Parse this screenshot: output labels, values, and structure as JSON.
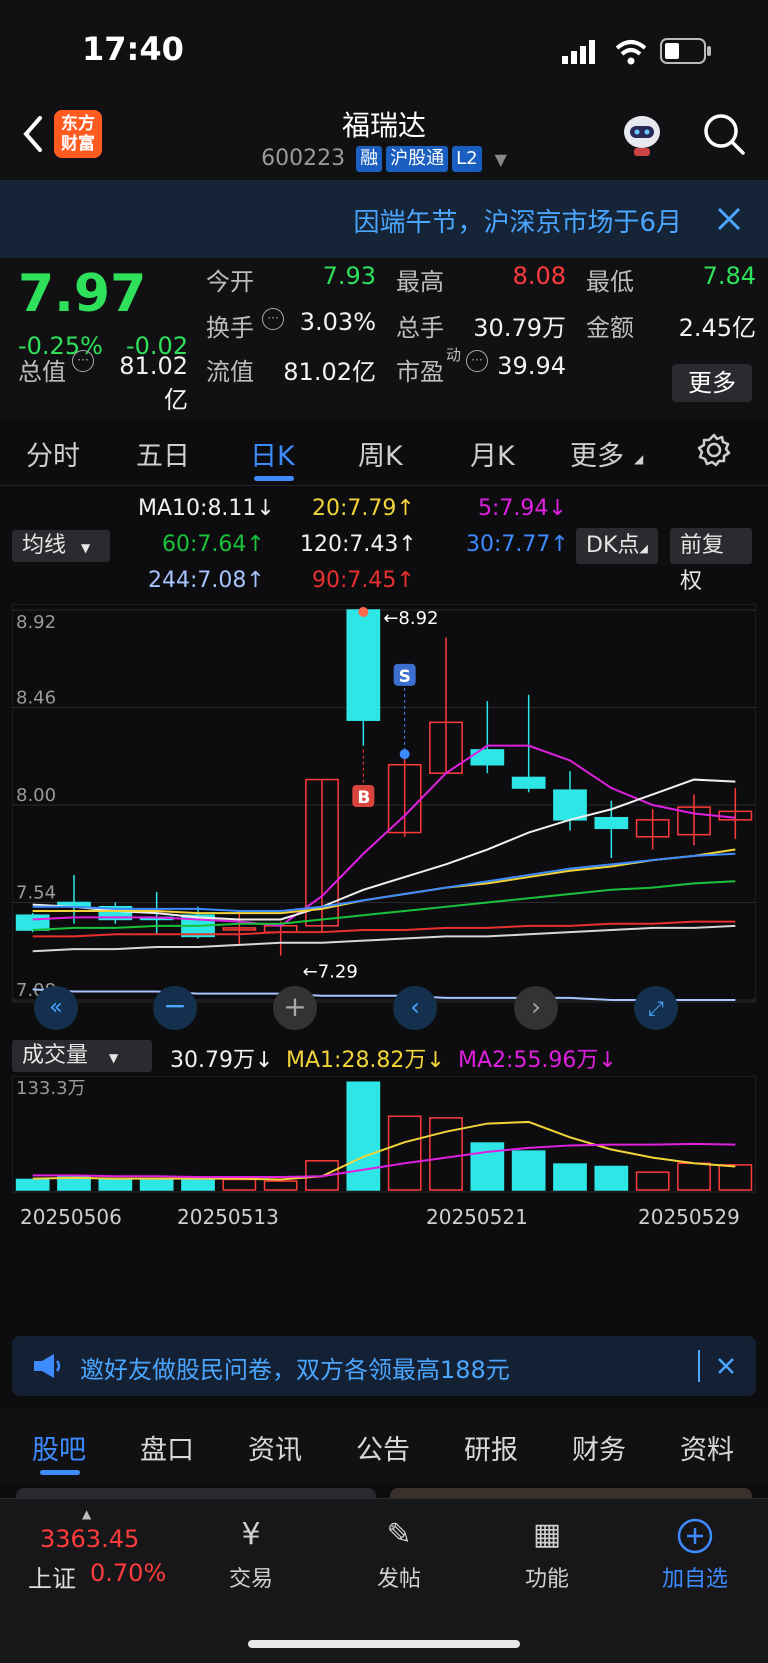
{
  "status": {
    "time": "17:40"
  },
  "header": {
    "logo_line1": "东方",
    "logo_line2": "财富",
    "title": "福瑞达",
    "code": "600223",
    "tags": [
      "融",
      "沪股通",
      "L2"
    ]
  },
  "notice": {
    "text": "因端午节，沪深京市场于6月"
  },
  "quote": {
    "price": "7.97",
    "change_pct": "-0.25%",
    "change": "-0.02",
    "open_label": "今开",
    "open": "7.93",
    "high_label": "最高",
    "high": "8.08",
    "low_label": "最低",
    "low": "7.84",
    "turnover_label": "换手",
    "turnover": "3.03%",
    "volume_label": "总手",
    "volume": "30.79万",
    "amount_label": "金额",
    "amount": "2.45亿",
    "mcap_label": "总值",
    "mcap": "81.02亿",
    "float_label": "流值",
    "float": "81.02亿",
    "pe_label": "市盈",
    "pe_sup": "动",
    "pe": "39.94",
    "more": "更多"
  },
  "tabs": [
    "分时",
    "五日",
    "日K",
    "周K",
    "月K",
    "更多"
  ],
  "ma": {
    "selector": "均线",
    "ma10": "MA10:8.11↓",
    "ma20": "20:7.79↑",
    "ma5": "5:7.94↓",
    "ma60": "60:7.64↑",
    "ma120": "120:7.43↑",
    "ma30": "30:7.77↑",
    "ma244": "244:7.08↑",
    "ma90": "90:7.45↑",
    "dk": "DK点",
    "fuquan": "前复权"
  },
  "chart_data": {
    "type": "candlestick",
    "y_ticks": [
      "8.92",
      "8.46",
      "8.00",
      "7.54",
      "7.08"
    ],
    "ylim": [
      7.08,
      8.92
    ],
    "high_marker": "←8.92",
    "low_marker": "←7.29",
    "signals": [
      "B",
      "S"
    ],
    "candles": [
      {
        "o": 7.48,
        "c": 7.41,
        "h": 7.49,
        "l": 7.4
      },
      {
        "o": 7.54,
        "c": 7.52,
        "h": 7.67,
        "l": 7.44
      },
      {
        "o": 7.52,
        "c": 7.46,
        "h": 7.54,
        "l": 7.44
      },
      {
        "o": 7.47,
        "c": 7.46,
        "h": 7.59,
        "l": 7.39
      },
      {
        "o": 7.48,
        "c": 7.38,
        "h": 7.52,
        "l": 7.37
      },
      {
        "o": 7.42,
        "c": 7.42,
        "h": 7.5,
        "l": 7.34
      },
      {
        "o": 7.4,
        "c": 7.43,
        "h": 7.45,
        "l": 7.29
      },
      {
        "o": 7.43,
        "c": 8.12,
        "h": 8.12,
        "l": 7.4
      },
      {
        "o": 8.92,
        "c": 8.4,
        "h": 8.92,
        "l": 8.28
      },
      {
        "o": 7.87,
        "c": 8.19,
        "h": 8.24,
        "l": 7.85
      },
      {
        "o": 8.15,
        "c": 8.39,
        "h": 8.79,
        "l": 8.15
      },
      {
        "o": 8.26,
        "c": 8.19,
        "h": 8.49,
        "l": 8.15
      },
      {
        "o": 8.13,
        "c": 8.08,
        "h": 8.52,
        "l": 8.06
      },
      {
        "o": 8.07,
        "c": 7.93,
        "h": 8.16,
        "l": 7.88
      },
      {
        "o": 7.94,
        "c": 7.89,
        "h": 8.02,
        "l": 7.75
      },
      {
        "o": 7.85,
        "c": 7.93,
        "h": 7.98,
        "l": 7.79
      },
      {
        "o": 7.86,
        "c": 7.99,
        "h": 8.05,
        "l": 7.81
      },
      {
        "o": 7.93,
        "c": 7.97,
        "h": 8.08,
        "l": 7.84
      }
    ],
    "ma_lines": [
      {
        "name": "MA5",
        "color": "#e020e0",
        "values": [
          7.46,
          7.47,
          7.47,
          7.47,
          7.46,
          7.45,
          7.43,
          7.57,
          7.77,
          7.95,
          8.15,
          8.28,
          8.28,
          8.21,
          8.08,
          8.0,
          7.96,
          7.94
        ]
      },
      {
        "name": "MA10",
        "color": "#f0f0f0",
        "values": [
          7.53,
          7.52,
          7.5,
          7.49,
          7.47,
          7.46,
          7.46,
          7.52,
          7.6,
          7.66,
          7.72,
          7.79,
          7.87,
          7.93,
          7.98,
          8.05,
          8.12,
          8.11
        ]
      },
      {
        "name": "MA20",
        "color": "#f2d43a",
        "values": [
          7.5,
          7.5,
          7.5,
          7.5,
          7.49,
          7.49,
          7.49,
          7.51,
          7.55,
          7.58,
          7.61,
          7.63,
          7.66,
          7.69,
          7.71,
          7.74,
          7.76,
          7.79
        ]
      },
      {
        "name": "MA30",
        "color": "#3d8bff",
        "values": [
          7.52,
          7.52,
          7.51,
          7.51,
          7.51,
          7.5,
          7.5,
          7.52,
          7.55,
          7.58,
          7.61,
          7.64,
          7.67,
          7.7,
          7.72,
          7.74,
          7.76,
          7.77
        ]
      },
      {
        "name": "MA60",
        "color": "#19c23a",
        "values": [
          7.41,
          7.42,
          7.42,
          7.43,
          7.43,
          7.44,
          7.44,
          7.46,
          7.48,
          7.5,
          7.52,
          7.54,
          7.56,
          7.58,
          7.6,
          7.61,
          7.63,
          7.64
        ]
      },
      {
        "name": "MA90",
        "color": "#e83030",
        "values": [
          7.38,
          7.38,
          7.39,
          7.39,
          7.39,
          7.39,
          7.4,
          7.4,
          7.41,
          7.41,
          7.42,
          7.42,
          7.43,
          7.43,
          7.44,
          7.44,
          7.45,
          7.45
        ]
      },
      {
        "name": "MA120",
        "color": "#d8d8d8",
        "values": [
          7.31,
          7.32,
          7.32,
          7.33,
          7.33,
          7.34,
          7.35,
          7.35,
          7.36,
          7.37,
          7.38,
          7.38,
          7.39,
          7.4,
          7.41,
          7.42,
          7.42,
          7.43
        ]
      },
      {
        "name": "MA244",
        "color": "#a8c4ff",
        "values": [
          7.13,
          7.12,
          7.12,
          7.12,
          7.11,
          7.11,
          7.11,
          7.1,
          7.1,
          7.1,
          7.09,
          7.09,
          7.09,
          7.09,
          7.08,
          7.08,
          7.08,
          7.08
        ]
      }
    ],
    "volume": {
      "selector": "成交量",
      "current": "30.79万↓",
      "ma1_label": "MA1:28.82万↓",
      "ma2_label": "MA2:55.96万↓",
      "max_label": "133.3万",
      "ylim": [
        0,
        133.3
      ],
      "values": [
        13,
        16,
        13,
        12,
        14,
        13,
        11,
        36,
        133,
        91,
        89,
        58,
        48,
        32,
        29,
        22,
        33,
        31
      ],
      "ma1": [
        14,
        15,
        14,
        14,
        14,
        14,
        13,
        17,
        41,
        59,
        72,
        82,
        84,
        65,
        50,
        40,
        33,
        29
      ],
      "ma2": [
        18,
        18,
        17,
        17,
        16,
        16,
        16,
        17,
        25,
        33,
        40,
        47,
        52,
        55,
        56,
        56,
        57,
        56
      ],
      "x_labels": [
        "20250506",
        "20250513",
        "20250521",
        "20250529"
      ]
    }
  },
  "invite": {
    "text": "邀好友做股民问卷，双方各领最高188元"
  },
  "bottom_tabs": [
    "股吧",
    "盘口",
    "资讯",
    "公告",
    "研报",
    "财务",
    "资料"
  ],
  "dock": {
    "index_value": "3363.45",
    "index_name": "上证",
    "index_pct": "0.70%",
    "trade": "交易",
    "post": "发帖",
    "func": "功能",
    "add": "加自选"
  },
  "colors": {
    "up": "#ff3b3b",
    "down": "#2ee6e6",
    "accent": "#3d8bff",
    "price_green": "#2fe05a"
  }
}
